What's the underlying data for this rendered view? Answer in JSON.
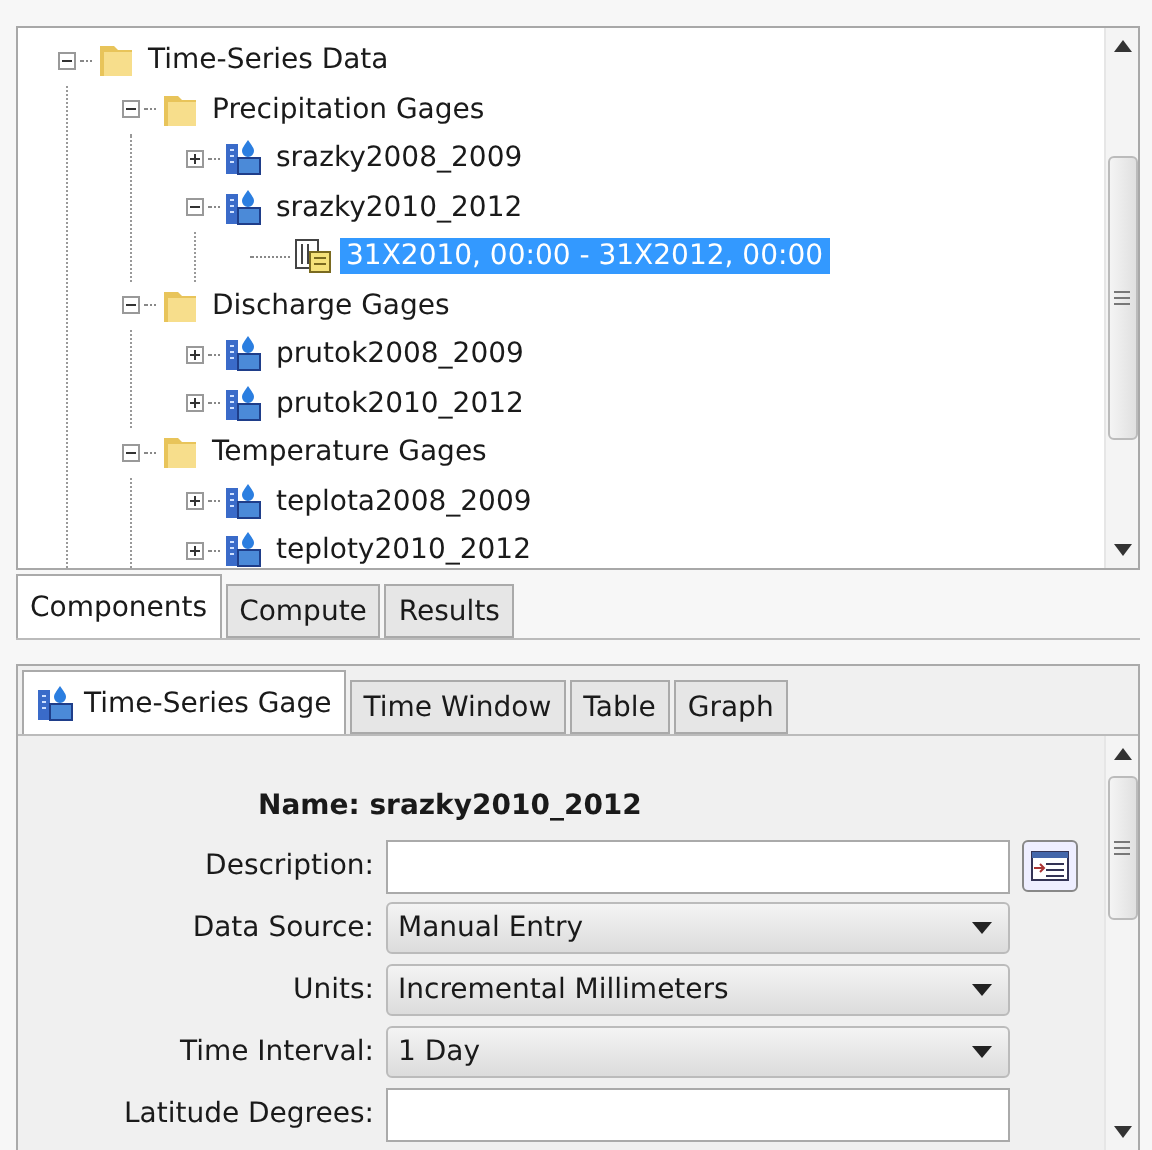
{
  "tree": [
    {
      "label": "Time-Series Data",
      "kind": "folder",
      "expanded": true,
      "selected": false,
      "children": [
        {
          "label": "Precipitation Gages",
          "kind": "folder",
          "expanded": true,
          "selected": false,
          "children": [
            {
              "label": "srazky2008_2009",
              "kind": "gage",
              "expanded": false,
              "selected": false
            },
            {
              "label": "srazky2010_2012",
              "kind": "gage",
              "expanded": true,
              "selected": false,
              "children": [
                {
                  "label": "31X2010, 00:00 - 31X2012, 00:00",
                  "kind": "record",
                  "selected": true
                }
              ]
            }
          ]
        },
        {
          "label": "Discharge Gages",
          "kind": "folder",
          "expanded": true,
          "selected": false,
          "children": [
            {
              "label": "prutok2008_2009",
              "kind": "gage",
              "expanded": false,
              "selected": false
            },
            {
              "label": "prutok2010_2012",
              "kind": "gage",
              "expanded": false,
              "selected": false
            }
          ]
        },
        {
          "label": "Temperature Gages",
          "kind": "folder",
          "expanded": true,
          "selected": false,
          "children": [
            {
              "label": "teplota2008_2009",
              "kind": "gage",
              "expanded": false,
              "selected": false
            },
            {
              "label": "teploty2010_2012",
              "kind": "gage",
              "expanded": false,
              "selected": false
            }
          ]
        }
      ]
    }
  ],
  "panel_tabs": [
    {
      "label": "Components",
      "selected": true
    },
    {
      "label": "Compute",
      "selected": false
    },
    {
      "label": "Results",
      "selected": false
    }
  ],
  "editor_tabs": [
    {
      "label": "Time-Series Gage",
      "selected": true,
      "kind": "gage"
    },
    {
      "label": "Time Window",
      "selected": false,
      "kind": "plain"
    },
    {
      "label": "Table",
      "selected": false,
      "kind": "plain"
    },
    {
      "label": "Graph",
      "selected": false,
      "kind": "plain"
    }
  ],
  "editor": {
    "name": "Name: srazky2010_2012",
    "fields": [
      {
        "label": "Description:",
        "kind": "text",
        "button": true
      },
      {
        "label": "Data Source:",
        "kind": "select",
        "value": "Manual Entry"
      },
      {
        "label": "Units:",
        "kind": "select",
        "value": "Incremental Millimeters"
      },
      {
        "label": "Time Interval:",
        "kind": "select",
        "value": "1 Day"
      },
      {
        "label": "Latitude Degrees:",
        "kind": "text"
      }
    ]
  }
}
